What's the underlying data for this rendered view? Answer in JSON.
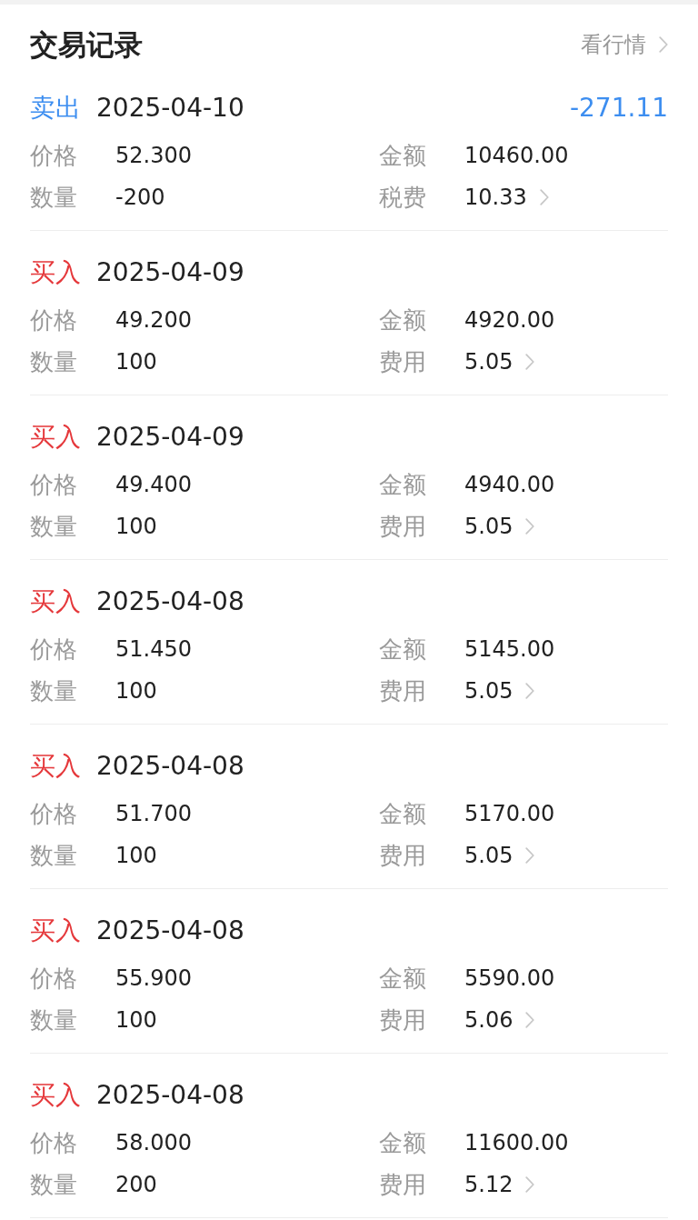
{
  "header": {
    "title": "交易记录",
    "link": "看行情"
  },
  "records": [
    {
      "kind": "sell",
      "action": "卖出",
      "date": "2025-04-10",
      "profit": "-271.11",
      "fields": [
        {
          "kind": "plain",
          "label": "价格",
          "value": "52.300"
        },
        {
          "kind": "plain",
          "label": "金额",
          "value": "10460.00"
        },
        {
          "kind": "plain",
          "label": "数量",
          "value": "-200"
        },
        {
          "kind": "link",
          "label": "税费",
          "value": "10.33"
        }
      ]
    },
    {
      "kind": "buy",
      "action": "买入",
      "date": "2025-04-09",
      "fields": [
        {
          "kind": "plain",
          "label": "价格",
          "value": "49.200"
        },
        {
          "kind": "plain",
          "label": "金额",
          "value": "4920.00"
        },
        {
          "kind": "plain",
          "label": "数量",
          "value": "100"
        },
        {
          "kind": "link",
          "label": "费用",
          "value": "5.05"
        }
      ]
    },
    {
      "kind": "buy",
      "action": "买入",
      "date": "2025-04-09",
      "fields": [
        {
          "kind": "plain",
          "label": "价格",
          "value": "49.400"
        },
        {
          "kind": "plain",
          "label": "金额",
          "value": "4940.00"
        },
        {
          "kind": "plain",
          "label": "数量",
          "value": "100"
        },
        {
          "kind": "link",
          "label": "费用",
          "value": "5.05"
        }
      ]
    },
    {
      "kind": "buy",
      "action": "买入",
      "date": "2025-04-08",
      "fields": [
        {
          "kind": "plain",
          "label": "价格",
          "value": "51.450"
        },
        {
          "kind": "plain",
          "label": "金额",
          "value": "5145.00"
        },
        {
          "kind": "plain",
          "label": "数量",
          "value": "100"
        },
        {
          "kind": "link",
          "label": "费用",
          "value": "5.05"
        }
      ]
    },
    {
      "kind": "buy",
      "action": "买入",
      "date": "2025-04-08",
      "fields": [
        {
          "kind": "plain",
          "label": "价格",
          "value": "51.700"
        },
        {
          "kind": "plain",
          "label": "金额",
          "value": "5170.00"
        },
        {
          "kind": "plain",
          "label": "数量",
          "value": "100"
        },
        {
          "kind": "link",
          "label": "费用",
          "value": "5.05"
        }
      ]
    },
    {
      "kind": "buy",
      "action": "买入",
      "date": "2025-04-08",
      "fields": [
        {
          "kind": "plain",
          "label": "价格",
          "value": "55.900"
        },
        {
          "kind": "plain",
          "label": "金额",
          "value": "5590.00"
        },
        {
          "kind": "plain",
          "label": "数量",
          "value": "100"
        },
        {
          "kind": "link",
          "label": "费用",
          "value": "5.06"
        }
      ]
    },
    {
      "kind": "buy",
      "action": "买入",
      "date": "2025-04-08",
      "fields": [
        {
          "kind": "plain",
          "label": "价格",
          "value": "58.000"
        },
        {
          "kind": "plain",
          "label": "金额",
          "value": "11600.00"
        },
        {
          "kind": "plain",
          "label": "数量",
          "value": "200"
        },
        {
          "kind": "link",
          "label": "费用",
          "value": "5.12"
        }
      ]
    }
  ]
}
